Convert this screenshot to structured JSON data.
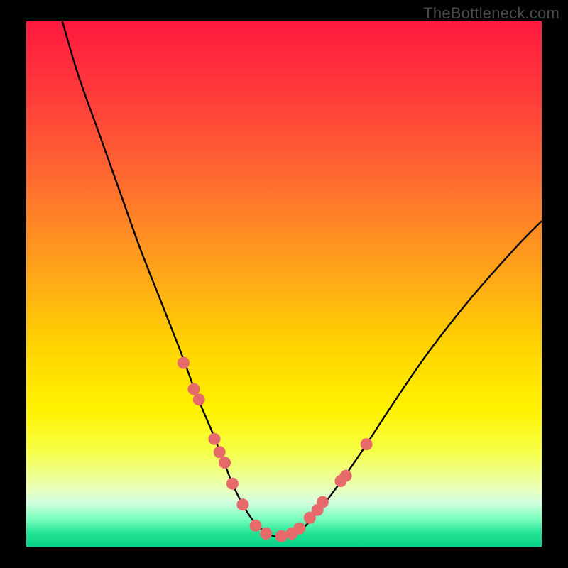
{
  "watermark": "TheBottleneck.com",
  "chart_data": {
    "type": "line",
    "title": "",
    "xlabel": "",
    "ylabel": "",
    "xlim": [
      0,
      100
    ],
    "ylim": [
      0,
      100
    ],
    "series": [
      {
        "name": "bottleneck-curve",
        "x": [
          7,
          10,
          14,
          18,
          22,
          26,
          30,
          33,
          36,
          38,
          40,
          42,
          44,
          46,
          48,
          50,
          53,
          56,
          60,
          65,
          71,
          78,
          86,
          95,
          100
        ],
        "y": [
          100,
          90,
          79,
          68,
          57,
          47,
          37,
          29,
          22,
          17,
          12,
          8,
          5,
          3,
          2,
          2,
          3,
          6,
          11,
          18,
          27,
          37,
          47,
          57,
          62
        ]
      }
    ],
    "markers": {
      "name": "highlight-points",
      "x": [
        30.5,
        32.5,
        33.5,
        36.5,
        37.5,
        38.5,
        40.0,
        42.0,
        44.5,
        46.5,
        49.5,
        51.5,
        53.0,
        55.0,
        56.5,
        57.5,
        61.0,
        62.0,
        66.0
      ],
      "y": [
        35.0,
        30.0,
        28.0,
        20.5,
        18.0,
        16.0,
        12.0,
        8.0,
        4.0,
        2.5,
        2.0,
        2.5,
        3.5,
        5.5,
        7.0,
        8.5,
        12.5,
        13.5,
        19.5
      ]
    },
    "gradient_stops": [
      {
        "offset": 0.0,
        "color": "#ff1a3f"
      },
      {
        "offset": 0.14,
        "color": "#ff3b3b"
      },
      {
        "offset": 0.3,
        "color": "#ff6a30"
      },
      {
        "offset": 0.48,
        "color": "#ffa619"
      },
      {
        "offset": 0.62,
        "color": "#ffd400"
      },
      {
        "offset": 0.74,
        "color": "#fff200"
      },
      {
        "offset": 0.82,
        "color": "#f6ff4a"
      },
      {
        "offset": 0.885,
        "color": "#eaffb0"
      },
      {
        "offset": 0.915,
        "color": "#d6ffe0"
      },
      {
        "offset": 0.945,
        "color": "#7fffc0"
      },
      {
        "offset": 0.975,
        "color": "#21e393"
      },
      {
        "offset": 1.0,
        "color": "#0ad088"
      }
    ],
    "marker_color": "#e66a6a",
    "curve_color": "#000000"
  }
}
